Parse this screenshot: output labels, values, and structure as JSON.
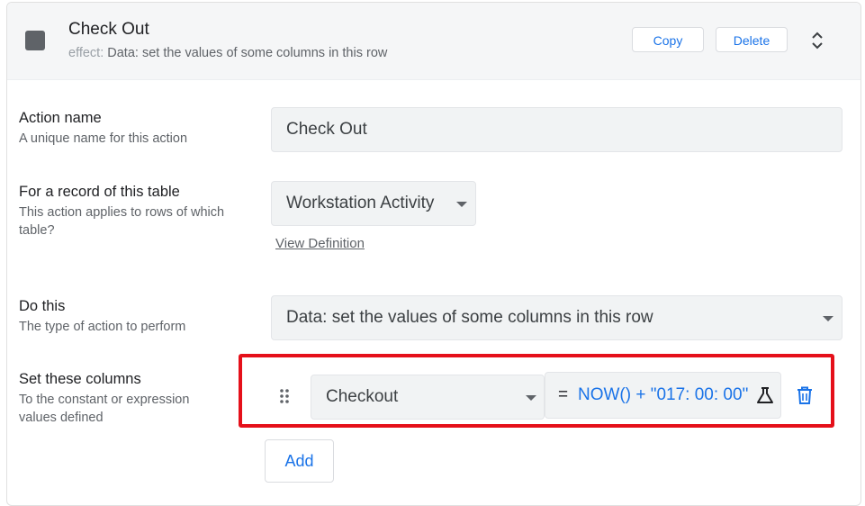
{
  "header": {
    "title": "Check Out",
    "effect_label": "effect:",
    "effect_value": "Data: set the values of some columns in this row",
    "copy_label": "Copy",
    "delete_label": "Delete",
    "icon_color": "#5f6368"
  },
  "form": {
    "action_name": {
      "label": "Action name",
      "help": "A unique name for this action",
      "value": "Check Out"
    },
    "table": {
      "label": "For a record of this table",
      "help": "This action applies to rows of which table?",
      "value": "Workstation Activity",
      "link": "View Definition"
    },
    "do_this": {
      "label": "Do this",
      "help": "The type of action to perform",
      "value": "Data: set the values of some columns in this row"
    },
    "set_columns": {
      "label": "Set these columns",
      "help": "To the constant or expression values defined",
      "rows": [
        {
          "column": "Checkout",
          "operator": "=",
          "expression": "NOW() + \"017: 00: 00\""
        }
      ],
      "add_label": "Add"
    }
  },
  "colors": {
    "accent": "#1a73e8",
    "highlight": "#e5101a",
    "field_bg": "#f1f3f4"
  }
}
